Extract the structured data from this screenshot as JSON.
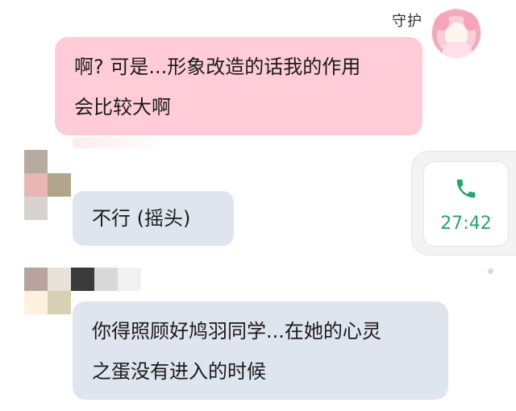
{
  "chat": {
    "sender_name": "守护",
    "messages": [
      {
        "side": "right",
        "text_line1": "啊? 可是...形象改造的话我的作用",
        "text_line2": "会比较大啊"
      },
      {
        "side": "left",
        "text": "不行 (摇头)"
      },
      {
        "side": "left",
        "text_line1": "你得照顾好鸠羽同学...在她的心灵",
        "text_line2": "之蛋没有进入的时候"
      }
    ]
  },
  "call_card": {
    "icon": "phone-icon",
    "duration": "27:42",
    "color": "#2aa46a"
  },
  "colors": {
    "pink_bubble": "#ffccd7",
    "gray_bubble": "#dfe5ee"
  }
}
